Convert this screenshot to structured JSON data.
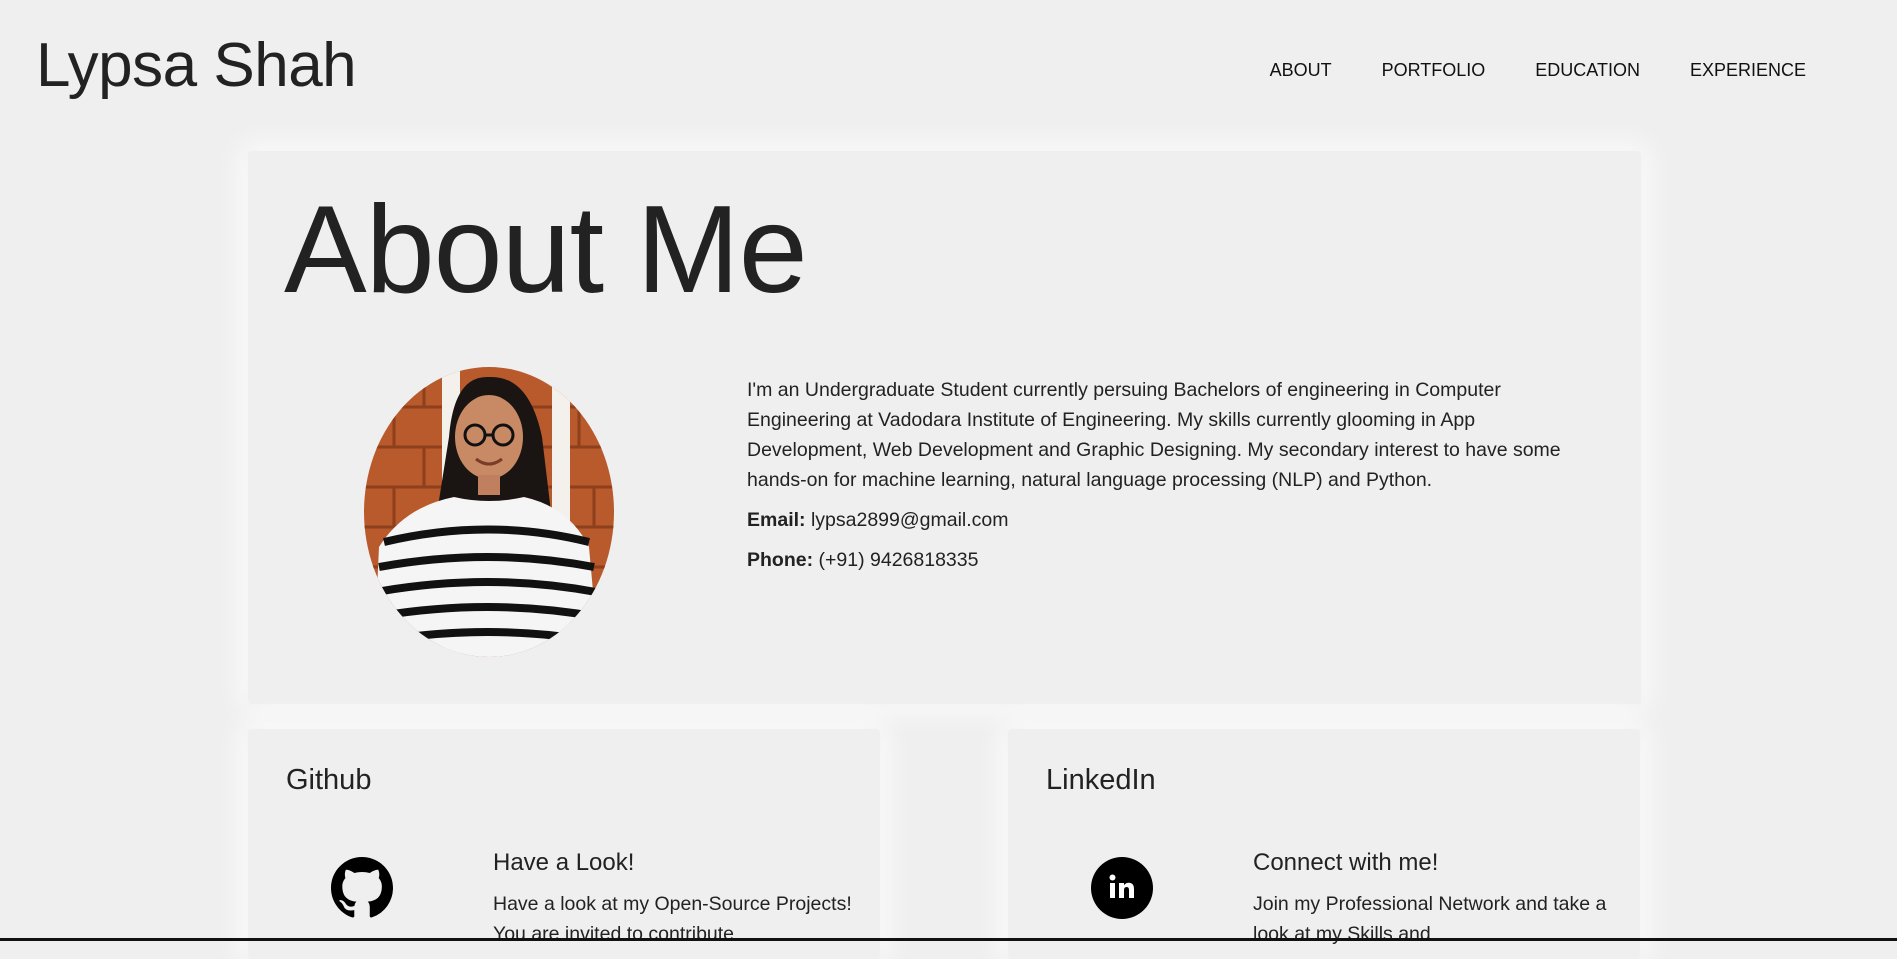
{
  "header": {
    "brand": "Lypsa Shah",
    "nav": [
      "ABOUT",
      "PORTFOLIO",
      "EDUCATION",
      "EXPERIENCE"
    ]
  },
  "about": {
    "title": "About Me",
    "bio": "I'm an Undergraduate Student currently persuing Bachelors of engineering in Computer Engineering at Vadodara Institute of Engineering. My skills currently glooming in App Development, Web Development and Graphic Designing. My secondary interest to have some hands-on for machine learning, natural language processing (NLP) and Python.",
    "email_label": "Email:",
    "email": "lypsa2899@gmail.com",
    "phone_label": "Phone:",
    "phone": "(+91) 9426818335",
    "avatar_icon": "profile-photo"
  },
  "github": {
    "title": "Github",
    "heading": "Have a Look!",
    "body": "Have a look at my Open-Source Projects! You are invited to contribute",
    "icon": "github-icon"
  },
  "linkedin": {
    "title": "LinkedIn",
    "heading": "Connect with me!",
    "body": "Join my Professional Network and take a look at my Skills and",
    "icon": "linkedin-icon"
  }
}
